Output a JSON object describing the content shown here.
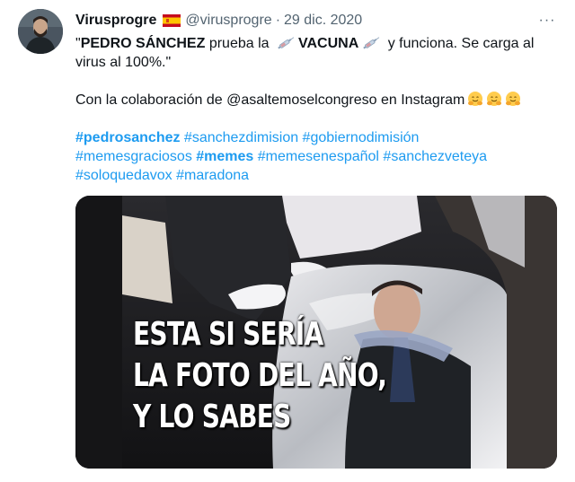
{
  "author": {
    "name": "Virusprogre",
    "handle": "@virusprogre",
    "separator": "·",
    "date": "29 dic. 2020",
    "more_glyph": "···"
  },
  "tweet": {
    "quote_open": "\"",
    "bold1": "PEDRO SÁNCHEZ",
    "text1": " prueba la ",
    "bold2": "VACUNA",
    "text2": " y funciona. Se carga al virus al 100%.\"",
    "para2": "Con la colaboración de @asaltemoselcongreso en Instagram",
    "hashtags_line1": [
      {
        "text": "#pedrosanchez",
        "bold": true
      },
      {
        "text": " #sanchezdimision #gobiernodimisión",
        "bold": false
      }
    ],
    "hashtags_line2": [
      {
        "text": "#memesgraciosos ",
        "bold": false
      },
      {
        "text": "#memes",
        "bold": true
      },
      {
        "text": " #memesenespañol #sanchezveteya",
        "bold": false
      }
    ],
    "hashtags_line3": "#soloquedavox #maradona"
  },
  "media": {
    "caption_line1": "ESTA SI SERÍA",
    "caption_line2": "LA FOTO DEL AÑO,",
    "caption_line3": "Y LO SABES"
  },
  "colors": {
    "link": "#1d9bf0",
    "secondary": "#536471",
    "text": "#0f1419"
  },
  "icons": {
    "flag": "spain-flag-icon",
    "syringe": "syringe-icon",
    "hug": "hugging-face-icon",
    "more": "more-icon"
  }
}
